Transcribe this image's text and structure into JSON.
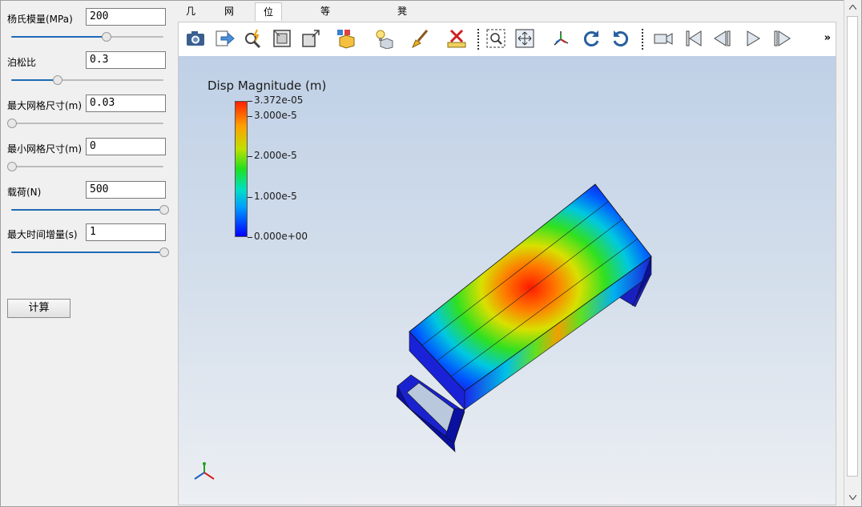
{
  "params": [
    {
      "label": "杨氏模量(MPa)",
      "value": "200",
      "slider": 0.62
    },
    {
      "label": "泊松比",
      "value": "0.3",
      "slider": 0.3
    },
    {
      "label": "最大网格尺寸(m)",
      "value": "0.03",
      "slider": 0.0
    },
    {
      "label": "最小网格尺寸(m)",
      "value": "0",
      "slider": 0.0
    },
    {
      "label": "载荷(N)",
      "value": "500",
      "slider": 1.0
    },
    {
      "label": "最大时间增量(s)",
      "value": "1",
      "slider": 1.0
    }
  ],
  "calc_button": "计算",
  "tabs": [
    {
      "label": "几何",
      "active": false
    },
    {
      "label": "网格",
      "active": false
    },
    {
      "label": "位移云图",
      "active": true
    },
    {
      "label": "等效应力云图",
      "active": false
    },
    {
      "label": "凳腿应力云图",
      "active": false
    }
  ],
  "toolbar": {
    "icons": [
      "camera-icon",
      "export-arrow-icon",
      "magnify-spark-icon",
      "box-fit-icon",
      "box-expand-icon",
      "selection-box-icon",
      "light-bulb-icon",
      "paint-brush-icon",
      "ruler-delete-icon",
      "zoom-region-icon",
      "pan-view-icon",
      "axis-orient-icon",
      "rotate-cw-icon",
      "rotate-ccw-icon",
      "video-camera-icon",
      "first-frame-icon",
      "step-back-icon",
      "play-icon",
      "step-forward-icon"
    ],
    "more": "»"
  },
  "legend": {
    "title": "Disp Magnitude (m)",
    "labels": [
      "3.372e-05",
      "3.000e-5",
      "2.000e-5",
      "1.000e-5",
      "0.000e+00"
    ],
    "values": [
      3.372e-05,
      3e-05,
      2e-05,
      1e-05,
      0.0
    ],
    "max": 3.372e-05
  },
  "colors": {
    "accent": "#1f6bb5",
    "model_blue": "#1a22d8"
  }
}
